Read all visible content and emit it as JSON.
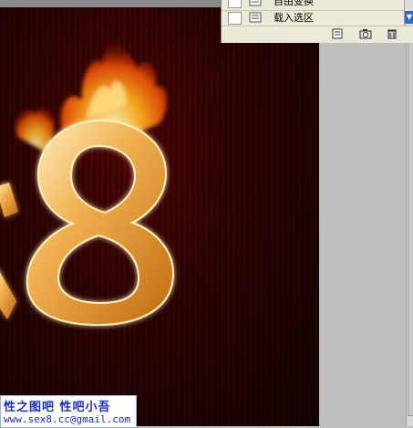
{
  "layers_panel": {
    "rows": [
      {
        "label": "自由变换"
      },
      {
        "label": "载入选区"
      }
    ]
  },
  "artwork": {
    "glyph_main": "8",
    "glyph_partial": "x"
  },
  "watermark": {
    "line1": "性之图吧 性吧小吾",
    "line2": "www.sex8.cc@gmail.com"
  },
  "colors": {
    "background_dark": "#2a0101",
    "gold": "#e6a23c",
    "fire": "#ff7a10"
  }
}
